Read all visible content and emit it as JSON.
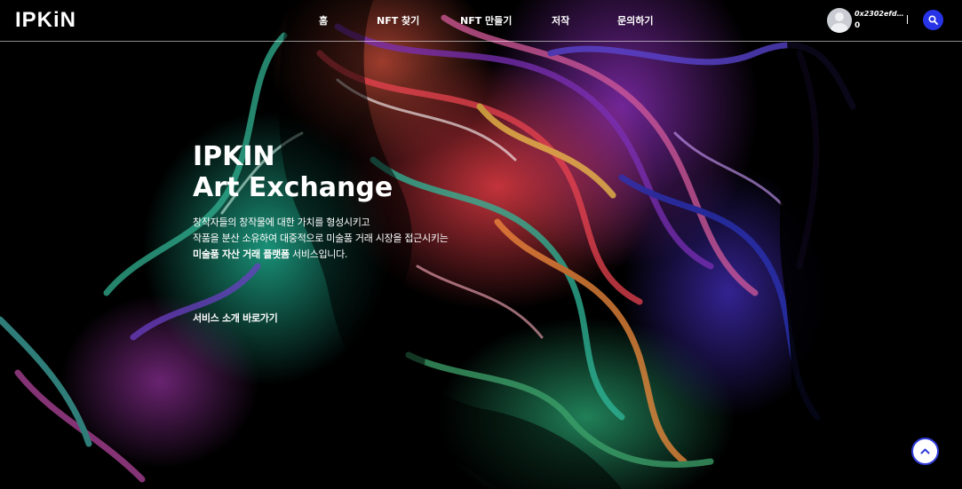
{
  "header": {
    "logo": "IPKiN",
    "nav": [
      {
        "label": "홈"
      },
      {
        "label": "NFT 찾기"
      },
      {
        "label": "NFT 만들기"
      },
      {
        "label": "저작"
      },
      {
        "label": "문의하기"
      }
    ],
    "wallet": {
      "address": "0x2302efdfa6...",
      "balance": "0"
    },
    "search_icon": "search-icon",
    "accent_color": "#2733e6"
  },
  "hero": {
    "title_line1": "IPKIN",
    "title_line2": "Art Exchange",
    "desc_line1": "창작자들의 창작물에 대한 가치를 형성시키고",
    "desc_line2": "작품을 분산 소유하여 대중적으로 미술품 거래 시장을 접근시키는",
    "desc_line3_strong": "미술품 자산 거래 플랫폼",
    "desc_line3_rest": " 서비스입니다.",
    "service_link": "서비스 소개 바로가기"
  },
  "scroll_top": {
    "icon": "chevron-up-icon"
  }
}
